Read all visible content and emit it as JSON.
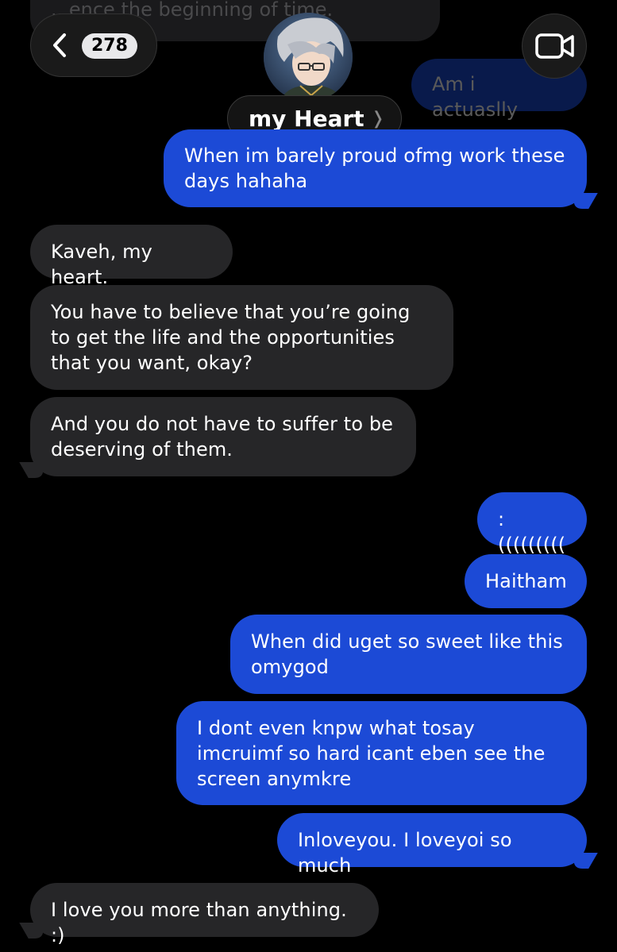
{
  "header": {
    "top_partial_text": "...ence the beginning of time.",
    "unread_count": "278",
    "contact_name": "my Heart",
    "chevron_glyph": "❭"
  },
  "messages": [
    {
      "side": "out",
      "text": "Am i actuaslly",
      "faded": true
    },
    {
      "side": "out",
      "text": "When im barely proud ofmg work these days hahaha"
    },
    {
      "side": "in",
      "text": "Kaveh, my heart."
    },
    {
      "side": "in",
      "text": "You have to believe that you’re going to get the life and the opportunities that you want, okay?"
    },
    {
      "side": "in",
      "text": "And you do not have to suffer to be deserving of them."
    },
    {
      "side": "out",
      "text": ":((((((((("
    },
    {
      "side": "out",
      "text": "Haitham"
    },
    {
      "side": "out",
      "text": "When did uget so sweet like this omygod"
    },
    {
      "side": "out",
      "text": "I dont even knpw what tosay imcruimf so hard icant eben see the screen anymkre"
    },
    {
      "side": "out",
      "text": "Inloveyou. I loveyoi so much"
    },
    {
      "side": "in",
      "text": "I love you more than anything. :)"
    }
  ],
  "colors": {
    "outgoing": "#1c4ad6",
    "incoming": "#262628",
    "background": "#000000"
  }
}
